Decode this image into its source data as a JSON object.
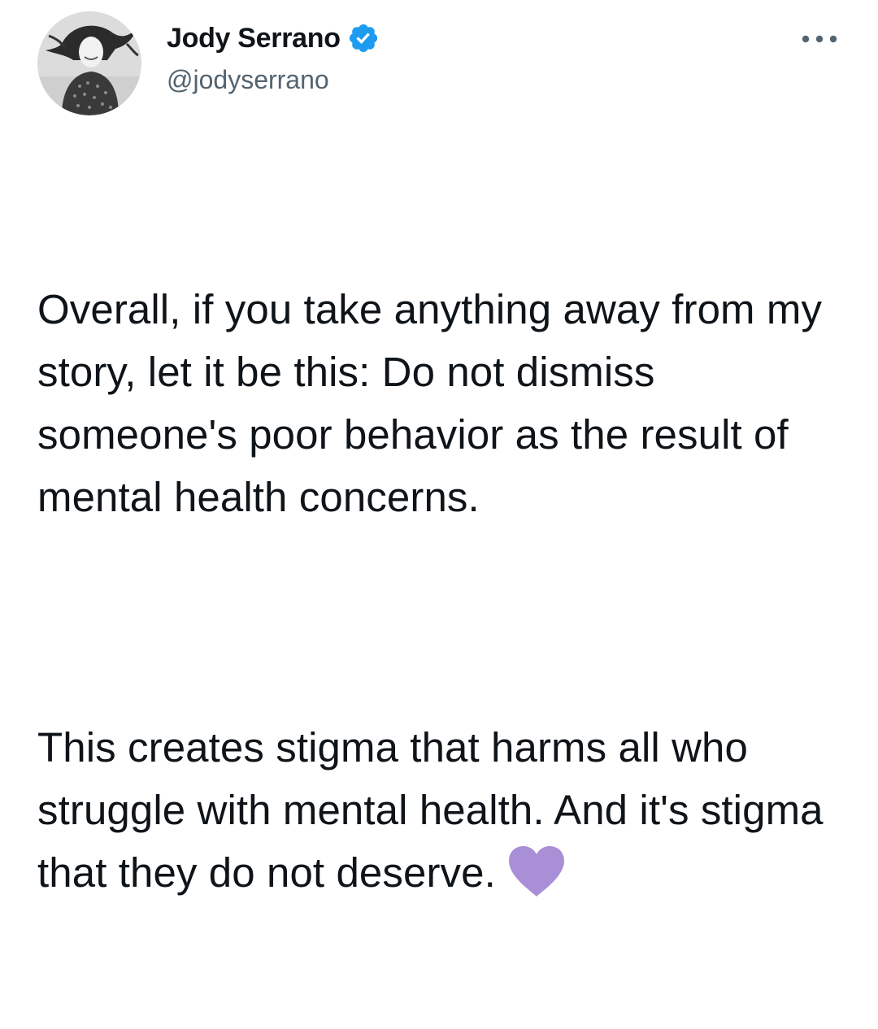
{
  "tweet": {
    "author": {
      "display_name": "Jody Serrano",
      "handle": "@jodyserrano",
      "verified": true,
      "avatar_icon": "profile-photo"
    },
    "more_icon": "more-options-icon",
    "paragraphs": [
      "Overall, if you take anything away from my story, let it be this: Do not dismiss someone's poor behavior as the result of mental health concerns.",
      "This creates stigma that harms all who struggle with mental health. And it's stigma that they do not deserve."
    ],
    "trailing_emoji": "purple-heart-icon"
  },
  "colors": {
    "text": "#0f1419",
    "secondary_text": "#536471",
    "verified_badge": "#1d9bf0",
    "heart": "#a98fd6",
    "background": "#ffffff"
  }
}
